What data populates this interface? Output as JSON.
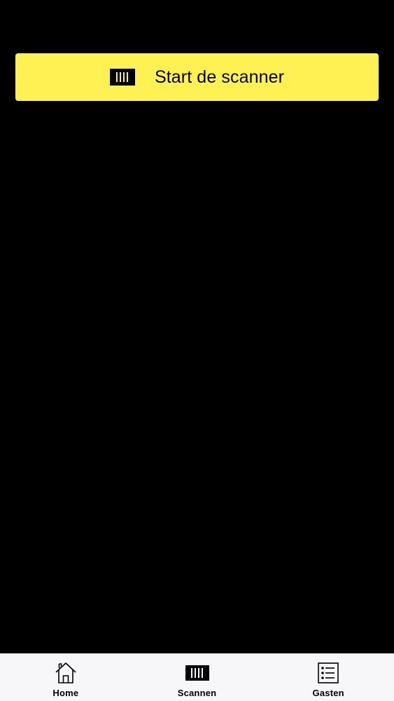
{
  "colors": {
    "background": "#000000",
    "accent": "#FFF154",
    "tabbar_background": "#F7F6F9",
    "icon": "#000000"
  },
  "scan_button": {
    "label": "Start de scanner",
    "icon": "barcode-scanner-icon"
  },
  "tabbar": {
    "tabs": [
      {
        "label": "Home",
        "icon": "home-icon"
      },
      {
        "label": "Scannen",
        "icon": "barcode-scanner-icon"
      },
      {
        "label": "Gasten",
        "icon": "list-icon"
      }
    ]
  }
}
